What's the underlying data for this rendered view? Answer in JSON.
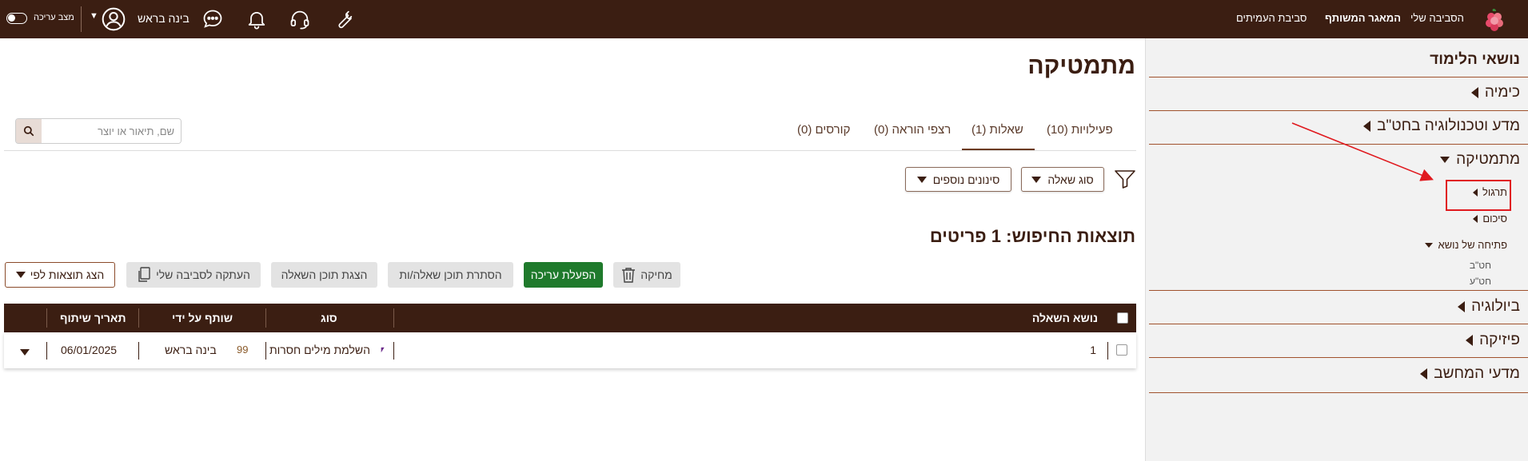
{
  "topbar": {
    "nav": {
      "my_env": "הסביבה שלי",
      "shared_repo": "המאגר המשותף",
      "peers_env": "סביבת העמיתים"
    },
    "user_name": "בינה בראש",
    "edit_mode_label": "מצב עריכה",
    "icons": [
      "wrench-icon",
      "headset-icon",
      "bell-icon",
      "chat-icon",
      "user-icon"
    ]
  },
  "sidebar": {
    "title": "נושאי הלימוד",
    "items": [
      {
        "label": "כימיה"
      },
      {
        "label": "מדע וטכנולוגיה בחט\"ב"
      },
      {
        "label": "מתמטיקה"
      },
      {
        "label": "ביולוגיה"
      },
      {
        "label": "פיזיקה"
      },
      {
        "label": "מדעי המחשב"
      }
    ],
    "math_children": [
      {
        "label": "תרגול"
      },
      {
        "label": "סיכום"
      },
      {
        "label": "פתיחה של נושא"
      }
    ],
    "topic_open_children": [
      {
        "label": "חט\"ב"
      },
      {
        "label": "חט\"ע"
      }
    ]
  },
  "main": {
    "title": "מתמטיקה",
    "tabs": [
      {
        "label": "פעילויות (10)"
      },
      {
        "label": "שאלות (1)"
      },
      {
        "label": "רצפי הוראה (0)"
      },
      {
        "label": "קורסים (0)"
      }
    ],
    "search": {
      "placeholder": "שם, תיאור או יוצר"
    },
    "filters": {
      "question_type": "סוג שאלה",
      "more_filters": "סינונים נוספים"
    },
    "results_title": "תוצאות החיפוש: 1 פריטים",
    "actions": {
      "delete": "מחיקה",
      "enable_edit": "הפעלת עריכה",
      "hide_content": "הסתרת תוכן שאלה/ות",
      "show_content": "הצגת תוכן השאלה",
      "copy_to_env": "העתקה לסביבה שלי",
      "show_by": "הצג תוצאות לפי"
    },
    "table": {
      "headers": {
        "subject": "נושא השאלה",
        "type": "סוג",
        "shared_by": "שותף על ידי",
        "share_date": "תאריך שיתוף"
      },
      "rows": [
        {
          "subject": "1",
          "type": "השלמת מילים חסרות",
          "shared_by": "בינה בראש",
          "share_date": "06/01/2025"
        }
      ]
    }
  },
  "colors": {
    "brand_dark": "#3b1e12",
    "action_green": "#1f7a2c",
    "highlight_red": "#e0191e"
  }
}
